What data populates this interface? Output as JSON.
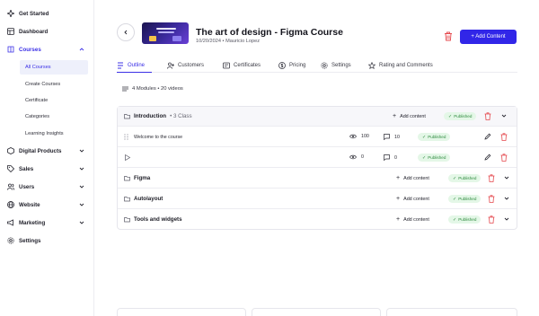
{
  "sidebar": {
    "items": [
      {
        "label": "Get Started",
        "icon": "sparkle-icon"
      },
      {
        "label": "Dashboard",
        "icon": "dashboard-icon"
      },
      {
        "label": "Courses",
        "icon": "book-icon"
      },
      {
        "label": "Digital Products",
        "icon": "box-icon"
      },
      {
        "label": "Sales",
        "icon": "tag-icon"
      },
      {
        "label": "Users",
        "icon": "users-icon"
      },
      {
        "label": "Website",
        "icon": "globe-icon"
      },
      {
        "label": "Marketing",
        "icon": "megaphone-icon"
      },
      {
        "label": "Settings",
        "icon": "gear-icon"
      }
    ],
    "courses_sub": [
      "All Courses",
      "Create Courses",
      "Certificate",
      "Categories",
      "Learning Insights"
    ]
  },
  "header": {
    "title": "The art of design - Figma Course",
    "meta": "10/20/2024 • Mauricio Lopez",
    "add_content_label": "+ Add Content"
  },
  "tabs": [
    "Outline",
    "Customers",
    "Certificates",
    "Pricing",
    "Settings",
    "Rating and Comments"
  ],
  "outline": {
    "summary": "4 Modules • 20 videos",
    "modules": [
      {
        "title": "Introduction",
        "sub": "• 3 Class",
        "add_label": "Add content",
        "status": "Published",
        "lessons": [
          {
            "name": "Welcome to the course",
            "views": "100",
            "comments": "10",
            "status": "Published"
          },
          {
            "name": "",
            "views": "0",
            "comments": "0",
            "status": "Published"
          }
        ]
      },
      {
        "title": "Figma",
        "add_label": "Add content",
        "status": "Published"
      },
      {
        "title": "Autolayout",
        "add_label": "Add content",
        "status": "Published"
      },
      {
        "title": "Tools and widgets",
        "add_label": "Add content",
        "status": "Published"
      }
    ]
  },
  "colors": {
    "accent": "#3126e8",
    "published_bg": "#e4f7e7",
    "published_text": "#2d8a3e",
    "danger": "#e5484d"
  }
}
